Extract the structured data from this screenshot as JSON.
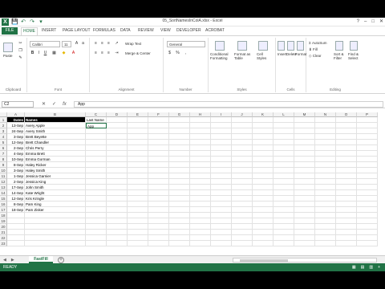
{
  "window": {
    "title": "05_SortNamesInColA.xlsx - Excel",
    "controls": [
      "?",
      "–",
      "□",
      "✕"
    ]
  },
  "qat": [
    "💾",
    "↶",
    "↷",
    "▾"
  ],
  "tabs": [
    "FILE",
    "HOME",
    "INSERT",
    "PAGE LAYOUT",
    "FORMULAS",
    "DATA",
    "REVIEW",
    "VIEW",
    "DEVELOPER",
    "ACROBAT"
  ],
  "ribbon": {
    "clipboard": {
      "label": "Clipboard",
      "paste": "Paste"
    },
    "font": {
      "label": "Font",
      "name": "Calibri",
      "size": "11",
      "bold": "B",
      "italic": "I",
      "underline": "U"
    },
    "alignment": {
      "label": "Alignment",
      "wrap": "Wrap Text",
      "merge": "Merge & Center"
    },
    "number": {
      "label": "Number",
      "format": "General",
      "currency": "$",
      "percent": "%",
      "comma": ","
    },
    "styles": {
      "label": "Styles",
      "conditional": "Conditional Formatting",
      "format_table": "Format as Table",
      "cell_styles": "Cell Styles"
    },
    "cells": {
      "label": "Cells",
      "insert": "Insert",
      "delete": "Delete",
      "format": "Format"
    },
    "editing": {
      "label": "Editing",
      "autosum": "AutoSum",
      "fill": "Fill",
      "clear": "Clear",
      "sort": "Sort & Filter",
      "find": "Find & Select"
    }
  },
  "formula_bar": {
    "name_box": "C2",
    "cancel": "✕",
    "enter": "✓",
    "fx": "fx",
    "value": "App"
  },
  "columns": [
    "A",
    "B",
    "C",
    "D",
    "E",
    "F",
    "G",
    "H",
    "I",
    "J",
    "K",
    "L",
    "M",
    "N",
    "O",
    "P"
  ],
  "rows": [
    {
      "n": "1",
      "a": "Dates",
      "b": "Names",
      "c": "Last Name"
    },
    {
      "n": "2",
      "a": "13-Sep",
      "b": "Avery Apple",
      "c": "App"
    },
    {
      "n": "3",
      "a": "24-Sep",
      "b": "Avery Smith",
      "c": ""
    },
    {
      "n": "4",
      "a": "3-Sep",
      "b": "Brett Beyette",
      "c": ""
    },
    {
      "n": "5",
      "a": "12-Sep",
      "b": "Brett Chandler",
      "c": ""
    },
    {
      "n": "6",
      "a": "2-Sep",
      "b": "Chris Perry",
      "c": ""
    },
    {
      "n": "7",
      "a": "4-Sep",
      "b": "Emma Brett",
      "c": ""
    },
    {
      "n": "8",
      "a": "10-Sep",
      "b": "Emma Gorman",
      "c": ""
    },
    {
      "n": "9",
      "a": "8-Sep",
      "b": "Haley Ricker",
      "c": ""
    },
    {
      "n": "10",
      "a": "3-Sep",
      "b": "Haley Smith",
      "c": ""
    },
    {
      "n": "11",
      "a": "1-Sep",
      "b": "Jessica Garnier",
      "c": ""
    },
    {
      "n": "12",
      "a": "2-Sep",
      "b": "Jessica King",
      "c": ""
    },
    {
      "n": "13",
      "a": "17-Sep",
      "b": "John Smith",
      "c": ""
    },
    {
      "n": "14",
      "a": "14-Sep",
      "b": "Kate Wright",
      "c": ""
    },
    {
      "n": "15",
      "a": "12-Sep",
      "b": "Kris Kringle",
      "c": ""
    },
    {
      "n": "16",
      "a": "8-Sep",
      "b": "Pam King",
      "c": ""
    },
    {
      "n": "17",
      "a": "18-Sep",
      "b": "Pam Zisker",
      "c": ""
    },
    {
      "n": "18",
      "a": "",
      "b": "",
      "c": ""
    },
    {
      "n": "19",
      "a": "",
      "b": "",
      "c": ""
    },
    {
      "n": "20",
      "a": "",
      "b": "",
      "c": ""
    },
    {
      "n": "21",
      "a": "",
      "b": "",
      "c": ""
    },
    {
      "n": "22",
      "a": "",
      "b": "",
      "c": ""
    },
    {
      "n": "23",
      "a": "",
      "b": "",
      "c": ""
    }
  ],
  "sheets": {
    "active": "FastFill",
    "nav": [
      "◀",
      "▶"
    ],
    "add": "+"
  },
  "status": {
    "mode": "READY",
    "right": [
      "▦",
      "▤",
      "▥",
      "+"
    ]
  },
  "colors": {
    "accent": "#217346",
    "header_fill": "#000000"
  }
}
